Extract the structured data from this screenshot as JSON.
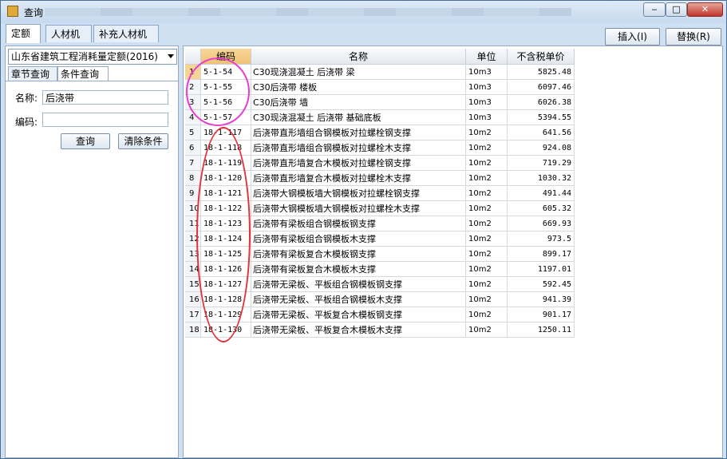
{
  "window": {
    "title": "查询",
    "controls": {
      "minimize": "‒",
      "maximize": "□",
      "close": "✕"
    }
  },
  "tabs": [
    {
      "label": "定额",
      "active": true
    },
    {
      "label": "人材机",
      "active": false
    },
    {
      "label": "补充人材机",
      "active": false
    }
  ],
  "toolbar": {
    "insert_label": "插入(I)",
    "replace_label": "替换(R)"
  },
  "left_panel": {
    "quota_library": "山东省建筑工程消耗量定额(2016)",
    "subtabs": [
      "章节查询",
      "条件查询"
    ],
    "name_label": "名称:",
    "name_value": "后浇带",
    "code_label": "编码:",
    "code_value": "",
    "query_button": "查询",
    "clear_button": "清除条件"
  },
  "grid": {
    "columns": [
      "编码",
      "名称",
      "单位",
      "不含税单价"
    ],
    "rows": [
      {
        "n": "1",
        "code": "5-1-54",
        "name": "C30现浇混凝土 后浇带 梁",
        "unit": "10m3",
        "price": "5825.48"
      },
      {
        "n": "2",
        "code": "5-1-55",
        "name": "C30后浇带 楼板",
        "unit": "10m3",
        "price": "6097.46"
      },
      {
        "n": "3",
        "code": "5-1-56",
        "name": "C30后浇带 墙",
        "unit": "10m3",
        "price": "6026.38"
      },
      {
        "n": "4",
        "code": "5-1-57",
        "name": "C30现浇混凝土 后浇带 基础底板",
        "unit": "10m3",
        "price": "5394.55"
      },
      {
        "n": "5",
        "code": "18-1-117",
        "name": "后浇带直形墙组合钢模板对拉螺栓钢支撑",
        "unit": "10m2",
        "price": "641.56"
      },
      {
        "n": "6",
        "code": "18-1-118",
        "name": "后浇带直形墙组合钢模板对拉螺栓木支撑",
        "unit": "10m2",
        "price": "924.08"
      },
      {
        "n": "7",
        "code": "18-1-119",
        "name": "后浇带直形墙复合木模板对拉螺栓钢支撑",
        "unit": "10m2",
        "price": "719.29"
      },
      {
        "n": "8",
        "code": "18-1-120",
        "name": "后浇带直形墙复合木模板对拉螺栓木支撑",
        "unit": "10m2",
        "price": "1030.32"
      },
      {
        "n": "9",
        "code": "18-1-121",
        "name": "后浇带大钢模板墙大钢模板对拉螺栓钢支撑",
        "unit": "10m2",
        "price": "491.44"
      },
      {
        "n": "10",
        "code": "18-1-122",
        "name": "后浇带大钢模板墙大钢模板对拉螺栓木支撑",
        "unit": "10m2",
        "price": "605.32"
      },
      {
        "n": "11",
        "code": "18-1-123",
        "name": "后浇带有梁板组合钢模板钢支撑",
        "unit": "10m2",
        "price": "669.93"
      },
      {
        "n": "12",
        "code": "18-1-124",
        "name": "后浇带有梁板组合钢模板木支撑",
        "unit": "10m2",
        "price": "973.5"
      },
      {
        "n": "13",
        "code": "18-1-125",
        "name": "后浇带有梁板复合木模板钢支撑",
        "unit": "10m2",
        "price": "899.17"
      },
      {
        "n": "14",
        "code": "18-1-126",
        "name": "后浇带有梁板复合木模板木支撑",
        "unit": "10m2",
        "price": "1197.01"
      },
      {
        "n": "15",
        "code": "18-1-127",
        "name": "后浇带无梁板、平板组合钢模板钢支撑",
        "unit": "10m2",
        "price": "592.45"
      },
      {
        "n": "16",
        "code": "18-1-128",
        "name": "后浇带无梁板、平板组合钢模板木支撑",
        "unit": "10m2",
        "price": "941.39"
      },
      {
        "n": "17",
        "code": "18-1-129",
        "name": "后浇带无梁板、平板复合木模板钢支撑",
        "unit": "10m2",
        "price": "901.17"
      },
      {
        "n": "18",
        "code": "18-1-130",
        "name": "后浇带无梁板、平板复合木模板木支撑",
        "unit": "10m2",
        "price": "1250.11"
      }
    ]
  },
  "annotations": {
    "magenta_ring": "#e63cd2",
    "red_ring": "#e6303a"
  }
}
